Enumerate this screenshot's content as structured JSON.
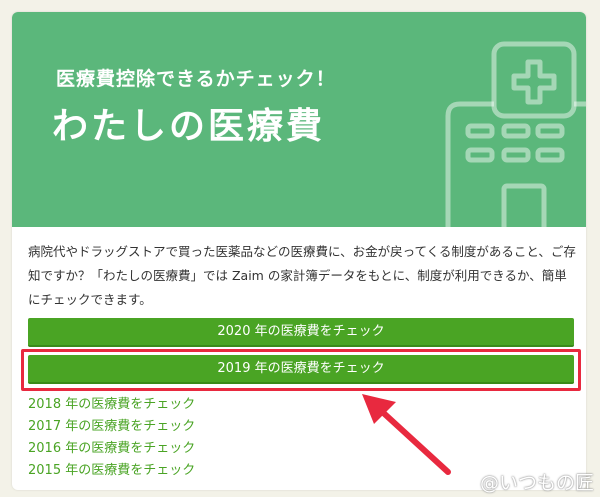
{
  "hero": {
    "subtitle": "医療費控除できるかチェック！",
    "title": "わたしの医療費",
    "illustration_icon": "hospital-building-icon",
    "background_color": "#5bb77b"
  },
  "description": "病院代やドラッグストアで買った医薬品などの医療費に、お金が戻ってくる制度があること、ご存知ですか？「わたしの医療費」では Zaim の家計簿データをもとに、制度が利用できるか、簡単にチェックできます。",
  "buttons": [
    {
      "label": "2020 年の医療費をチェック"
    },
    {
      "label": "2019 年の医療費をチェック"
    }
  ],
  "year_links": [
    {
      "label": "2018 年の医療費をチェック"
    },
    {
      "label": "2017 年の医療費をチェック"
    },
    {
      "label": "2016 年の医療費をチェック"
    },
    {
      "label": "2015 年の医療費をチェック"
    }
  ],
  "accent_color": "#4aa424",
  "highlight_color": "#e8293f",
  "annotation_arrow_icon": "red-arrow-icon",
  "watermark": "@いつもの匠"
}
